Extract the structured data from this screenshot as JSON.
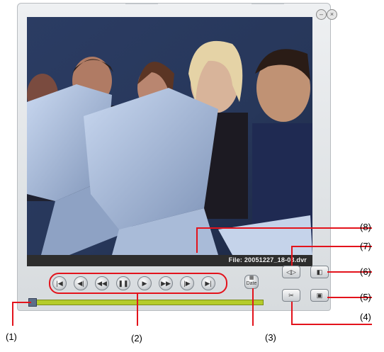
{
  "player": {
    "file_label": "File: 20051227_18-03.dvr",
    "controls": {
      "first_icon": "skip-to-start-icon",
      "step_back_icon": "step-back-icon",
      "rewind_icon": "rewind-icon",
      "pause_icon": "pause-icon",
      "play_icon": "play-icon",
      "fast_forward_icon": "fast-forward-icon",
      "step_forward_icon": "step-forward-icon",
      "last_icon": "skip-to-end-icon"
    },
    "date_button_label": "Date",
    "progress_percent": 2
  },
  "callouts": {
    "c1": "(1)",
    "c2": "(2)",
    "c3": "(3)",
    "c4": "(4)",
    "c5": "(5)",
    "c6": "(6)",
    "c7": "(7)",
    "c8": "(8)"
  }
}
